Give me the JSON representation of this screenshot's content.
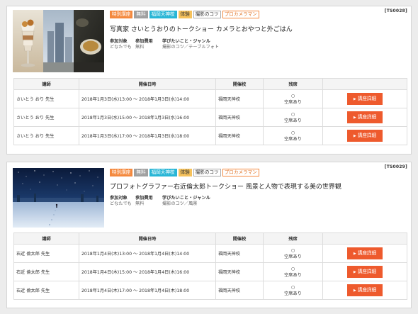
{
  "events": [
    {
      "code": "[TS0028]",
      "tags": [
        {
          "label": "特別講座",
          "style": "tag-orange-fill"
        },
        {
          "label": "無料",
          "style": "tag-grey-fill"
        },
        {
          "label": "福岡天神校",
          "style": "tag-cyan-fill"
        },
        {
          "label": "体験",
          "style": "tag-yellow-fill"
        },
        {
          "label": "撮影のコツ",
          "style": "tag-grey-outline"
        },
        {
          "label": "プロカメラマン",
          "style": "tag-orange-outline"
        }
      ],
      "title": "写真家 さいとうおりのトークショー カメラとおやつと外ごはん",
      "meta": {
        "target_label": "参加対象",
        "target_value": "どなたでも",
        "fee_label": "参加費用",
        "fee_value": "無料",
        "genre_label": "学びたいこと・ジャンル",
        "genre_value": "撮影のコツ／テーブルフォト"
      },
      "table": {
        "headers": [
          "講師",
          "開催日時",
          "開催校",
          "残席",
          ""
        ],
        "rows": [
          {
            "teacher": "さいとう おり 先生",
            "datetime": "2018年1月3日(水)13:00 ～ 2018年1月3日(水)14:00",
            "school": "福岡天神校",
            "mark": "○",
            "status": "空席あり",
            "button": "講座詳細"
          },
          {
            "teacher": "さいとう おり 先生",
            "datetime": "2018年1月3日(水)15:00 ～ 2018年1月3日(水)16:00",
            "school": "福岡天神校",
            "mark": "○",
            "status": "空席あり",
            "button": "講座詳細"
          },
          {
            "teacher": "さいとう おり 先生",
            "datetime": "2018年1月3日(水)17:00 ～ 2018年1月3日(水)18:00",
            "school": "福岡天神校",
            "mark": "○",
            "status": "空席あり",
            "button": "講座詳細"
          }
        ]
      }
    },
    {
      "code": "[TS0029]",
      "tags": [
        {
          "label": "特別講座",
          "style": "tag-orange-fill"
        },
        {
          "label": "無料",
          "style": "tag-grey-fill"
        },
        {
          "label": "福岡天神校",
          "style": "tag-cyan-fill"
        },
        {
          "label": "体験",
          "style": "tag-yellow-fill"
        },
        {
          "label": "撮影のコツ",
          "style": "tag-grey-outline"
        },
        {
          "label": "プロカメラマン",
          "style": "tag-orange-outline"
        }
      ],
      "title": "プロフォトグラファー右近倫太郎トークショー 風景と人物で表現する美の世界観",
      "meta": {
        "target_label": "参加対象",
        "target_value": "どなたでも",
        "fee_label": "参加費用",
        "fee_value": "無料",
        "genre_label": "学びたいこと・ジャンル",
        "genre_value": "撮影のコツ／風景"
      },
      "table": {
        "headers": [
          "講師",
          "開催日時",
          "開催校",
          "残席",
          ""
        ],
        "rows": [
          {
            "teacher": "右近 倫太郎 先生",
            "datetime": "2018年1月4日(木)13:00 ～ 2018年1月4日(木)14:00",
            "school": "福岡天神校",
            "mark": "○",
            "status": "空席あり",
            "button": "講座詳細"
          },
          {
            "teacher": "右近 倫太郎 先生",
            "datetime": "2018年1月4日(木)15:00 ～ 2018年1月4日(木)16:00",
            "school": "福岡天神校",
            "mark": "○",
            "status": "空席あり",
            "button": "講座詳細"
          },
          {
            "teacher": "右近 倫太郎 先生",
            "datetime": "2018年1月4日(木)17:00 ～ 2018年1月4日(木)18:00",
            "school": "福岡天神校",
            "mark": "○",
            "status": "空席あり",
            "button": "講座詳細"
          }
        ]
      }
    }
  ],
  "colors": {
    "accent": "#ee5a2d",
    "tag_orange": "#f4893e",
    "tag_cyan": "#29b6d6",
    "tag_yellow": "#f6c25c",
    "tag_grey": "#a0a0a0"
  }
}
